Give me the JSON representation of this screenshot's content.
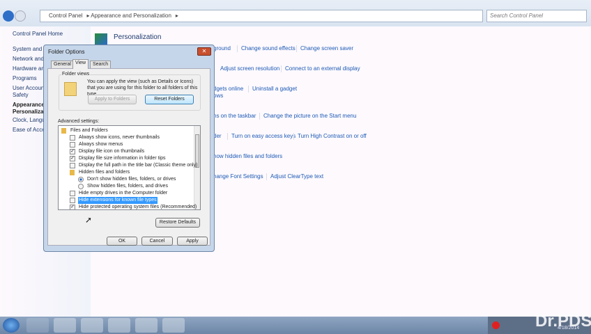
{
  "address": {
    "crumbs": [
      "Control Panel",
      "Appearance and Personalization"
    ],
    "search_placeholder": "Search Control Panel"
  },
  "leftnav": [
    "Control Panel Home",
    "System and S",
    "Network and",
    "Hardware and",
    "Programs",
    "User Account",
    "Safety",
    "Appearance a",
    "Personalizati",
    "Clock, Langu",
    "Ease of Acces"
  ],
  "main": {
    "title": "Personalization",
    "links": [
      [
        "ground",
        "Change sound effects",
        "Change screen saver"
      ],
      [
        "Adjust screen resolution",
        "Connect to an external display"
      ],
      [
        "dgets online",
        "Uninstall a gadget"
      ],
      [
        "ows"
      ],
      [
        "ns on the taskbar",
        "Change the picture on the Start menu"
      ],
      [
        "der",
        "Turn on easy access keys",
        "Turn High Contrast on or off"
      ],
      [
        "how hidden files and folders"
      ],
      [
        "hange Font Settings",
        "Adjust ClearType text"
      ]
    ]
  },
  "dialog": {
    "title": "Folder Options",
    "tabs": [
      "General",
      "View",
      "Search"
    ],
    "active_tab": "View",
    "folder_views": {
      "label": "Folder views",
      "text": "You can apply the view (such as Details or Icons) that you are using for this folder to all folders of this type.",
      "apply": "Apply to Folders",
      "reset": "Reset Folders"
    },
    "advanced_label": "Advanced settings:",
    "items": [
      {
        "type": "folder",
        "label": "Files and Folders",
        "indent": 0
      },
      {
        "type": "check",
        "label": "Always show icons, never thumbnails",
        "checked": false,
        "indent": 1
      },
      {
        "type": "check",
        "label": "Always show menus",
        "checked": false,
        "indent": 1
      },
      {
        "type": "check",
        "label": "Display file icon on thumbnails",
        "checked": true,
        "indent": 1
      },
      {
        "type": "check",
        "label": "Display file size information in folder tips",
        "checked": true,
        "indent": 1
      },
      {
        "type": "check",
        "label": "Display the full path in the title bar (Classic theme only)",
        "checked": false,
        "indent": 1
      },
      {
        "type": "folder",
        "label": "Hidden files and folders",
        "indent": 1
      },
      {
        "type": "radio",
        "label": "Don't show hidden files, folders, or drives",
        "checked": true,
        "indent": 2
      },
      {
        "type": "radio",
        "label": "Show hidden files, folders, and drives",
        "checked": false,
        "indent": 2
      },
      {
        "type": "check",
        "label": "Hide empty drives in the Computer folder",
        "checked": false,
        "indent": 1
      },
      {
        "type": "check",
        "label": "Hide extensions for known file types",
        "checked": false,
        "indent": 1,
        "selected": true
      },
      {
        "type": "check",
        "label": "Hide protected operating system files (Recommended)",
        "checked": true,
        "indent": 1
      }
    ],
    "restore": "Restore Defaults",
    "ok": "OK",
    "cancel": "Cancel",
    "apply": "Apply"
  },
  "taskbar": {
    "apps": [
      "start",
      "media-player",
      "explorer",
      "chrome",
      "app",
      "control-panel",
      "folder-options"
    ],
    "date": "4/18/2014"
  },
  "watermark": "Dr.PDS",
  "colors": {
    "link": "#1d5ab5",
    "selection": "#3399ff",
    "taskbar": "#6d86a6"
  }
}
